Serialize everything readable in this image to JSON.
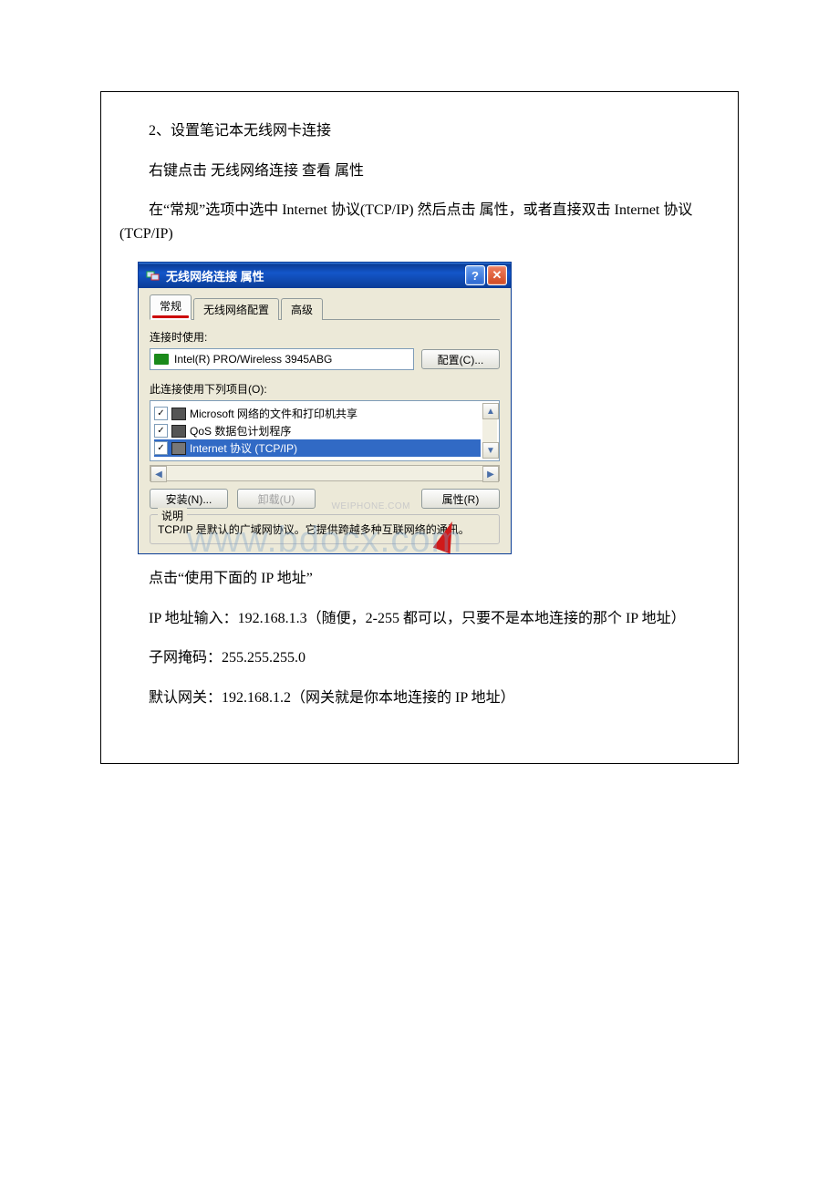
{
  "doc": {
    "p1": "2、设置笔记本无线网卡连接",
    "p2": "右键点击 无线网络连接 查看 属性",
    "p3": "在“常规”选项中选中 Internet 协议(TCP/IP) 然后点击 属性，或者直接双击 Internet 协议(TCP/IP)",
    "p4": "点击“使用下面的 IP 地址”",
    "p5a": "IP 地址输入：192.168.1.3（随便，2-255 都可以，只要不是本地连接的那个 IP 地址）",
    "p6": "子网掩码：255.255.255.0",
    "p7": "默认网关：192.168.1.2（网关就是你本地连接的 IP 地址）"
  },
  "dialog": {
    "title": "无线网络连接  属性",
    "tabs": {
      "general": "常规",
      "wireless": "无线网络配置",
      "advanced": "高级"
    },
    "connect_using_label": "连接时使用:",
    "adapter": "Intel(R) PRO/Wireless 3945ABG",
    "configure_btn": "配置(C)...",
    "items_label": "此连接使用下列项目(O):",
    "items": {
      "i0": "Microsoft 网络的文件和打印机共享",
      "i1": "QoS 数据包计划程序",
      "i2": "Internet 协议 (TCP/IP)"
    },
    "install_btn": "安装(N)...",
    "uninstall_btn": "卸载(U)",
    "properties_btn": "属性(R)",
    "desc_legend": "说明",
    "desc_text": "TCP/IP 是默认的广域网协议。它提供跨越多种互联网络的通讯。"
  },
  "watermark": "www.bdocx.com",
  "small_watermark": "WEIPHONE.COM"
}
